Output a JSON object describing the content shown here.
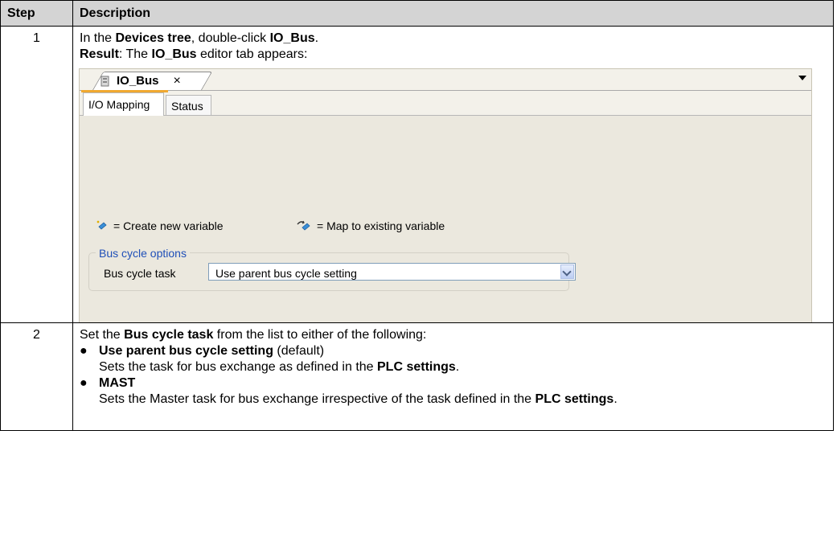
{
  "table": {
    "headers": {
      "step": "Step",
      "description": "Description"
    }
  },
  "step1": {
    "number": "1",
    "line1": {
      "pre": "In the ",
      "b1": "Devices tree",
      "mid": ", double-click ",
      "b2": "IO_Bus",
      "post": "."
    },
    "line2": {
      "b1": "Result",
      "mid": ": The ",
      "b2": "IO_Bus",
      "post": " editor tab appears:"
    }
  },
  "editor": {
    "tab_title": "IO_Bus",
    "close_glyph": "×",
    "icon": "device-icon",
    "subtabs": [
      "I/O Mapping",
      "Status"
    ],
    "legend_create": "= Create new variable",
    "legend_map": "= Map to existing variable",
    "group_title": "Bus cycle options",
    "field_label": "Bus cycle task",
    "field_value": "Use parent bus cycle setting",
    "accent_color": "#f0a830",
    "group_title_color": "#1f4fb8"
  },
  "step2": {
    "number": "2",
    "intro": {
      "pre": "Set the ",
      "b1": "Bus cycle task",
      "post": " from the list to either of the following:"
    },
    "bullets": [
      {
        "title": "Use parent bus cycle setting",
        "suffix": " (default)",
        "text_pre": "Sets the task for bus exchange as defined in the ",
        "text_b": "PLC settings",
        "text_post": "."
      },
      {
        "title": "MAST",
        "suffix": "",
        "text_pre": "Sets the Master task for bus exchange irrespective of the task defined in the ",
        "text_b": "PLC settings",
        "text_post": "."
      }
    ]
  }
}
